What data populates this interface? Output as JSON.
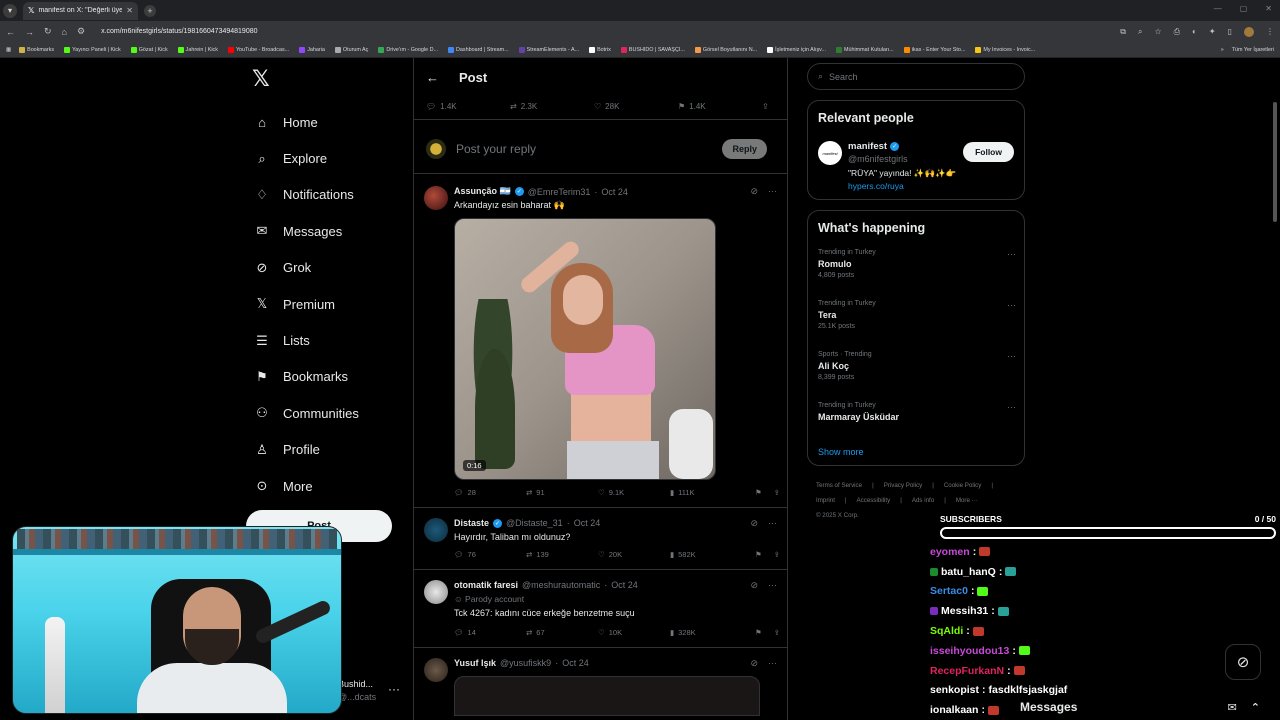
{
  "browser": {
    "tab_title": "manifest on X: \"Değerli üyemiz...",
    "url": "x.com/m6nifestgirls/status/1981660473494819080",
    "bookmarks": [
      {
        "label": "Bookmarks",
        "color": "#d0b24a"
      },
      {
        "label": "Yayıncı Paneli | Kick",
        "color": "#53fc18"
      },
      {
        "label": "Gözat | Kick",
        "color": "#53fc18"
      },
      {
        "label": "Jahrein | Kick",
        "color": "#53fc18"
      },
      {
        "label": "YouTube - Broadcas...",
        "color": "#ff0000"
      },
      {
        "label": "Jaharia",
        "color": "#9146ff"
      },
      {
        "label": "Oturum Aç",
        "color": "#aaaaaa"
      },
      {
        "label": "Drive'ım - Google D...",
        "color": "#34a853"
      },
      {
        "label": "Dashboard | Stream...",
        "color": "#4285f4"
      },
      {
        "label": "StreamElements - A...",
        "color": "#6441a5"
      },
      {
        "label": "Botrix",
        "color": "#ffffff"
      },
      {
        "label": "BUSHIDO | SAVAŞÇI...",
        "color": "#e0245e"
      },
      {
        "label": "Görsel Boyutlanını N...",
        "color": "#f2994a"
      },
      {
        "label": "İşletmeniz için Alışv...",
        "color": "#ffffff"
      },
      {
        "label": "Mühimmat Kutuları...",
        "color": "#2e7d32"
      },
      {
        "label": "ikas - Enter Your Sto...",
        "color": "#ff8a00"
      },
      {
        "label": "My Invoices - Invoic...",
        "color": "#f5c518"
      }
    ],
    "bookmarks_right": "Tüm Yer İşaretleri"
  },
  "nav": {
    "items": [
      {
        "label": "Home",
        "icon": "home-icon"
      },
      {
        "label": "Explore",
        "icon": "search-icon"
      },
      {
        "label": "Notifications",
        "icon": "bell-icon"
      },
      {
        "label": "Messages",
        "icon": "envelope-icon"
      },
      {
        "label": "Grok",
        "icon": "grok-icon"
      },
      {
        "label": "Premium",
        "icon": "x-premium-icon"
      },
      {
        "label": "Lists",
        "icon": "list-icon"
      },
      {
        "label": "Bookmarks",
        "icon": "bookmark-icon"
      },
      {
        "label": "Communities",
        "icon": "communities-icon"
      },
      {
        "label": "Profile",
        "icon": "person-icon"
      },
      {
        "label": "More",
        "icon": "more-circle-icon"
      }
    ],
    "post_button": "Post",
    "account_name": "Bushid...",
    "account_handle": "@...dcats"
  },
  "center": {
    "title": "Post",
    "main_post_stats": {
      "replies": "1.4K",
      "reposts": "2.3K",
      "likes": "28K",
      "bookmarks": "1.4K"
    },
    "reply_placeholder": "Post your reply",
    "reply_button": "Reply",
    "replies": [
      {
        "name": "Assunção 🇦🇷",
        "handle": "@EmreTerim31",
        "date": "Oct 24",
        "text": "Arkandayız esin baharat 🙌",
        "video_time": "0:16",
        "stats": {
          "replies": "28",
          "reposts": "91",
          "likes": "9.1K",
          "views": "111K"
        }
      },
      {
        "name": "Distaste",
        "handle": "@Distaste_31",
        "date": "Oct 24",
        "text": "Hayırdır, Taliban mı oldunuz?",
        "stats": {
          "replies": "76",
          "reposts": "139",
          "likes": "20K",
          "views": "582K"
        }
      },
      {
        "name": "otomatik faresi",
        "handle": "@meshurautomatic",
        "date": "Oct 24",
        "parody": "Parody account",
        "text": "Tck 4267: kadını cüce erkeğe benzetme suçu",
        "stats": {
          "replies": "14",
          "reposts": "67",
          "likes": "10K",
          "views": "328K"
        }
      },
      {
        "name": "Yusuf Işık",
        "handle": "@yusufiskk9",
        "date": "Oct 24"
      }
    ]
  },
  "right": {
    "search_placeholder": "Search",
    "relevant_title": "Relevant people",
    "relevant": {
      "name": "manifest",
      "handle": "@m6nifestgirls",
      "bio": "\"RÜYA\" yayında! ✨🙌✨👉",
      "link": "hypers.co/ruya",
      "follow": "Follow",
      "avatar_text": "manifest"
    },
    "happening_title": "What's happening",
    "trends": [
      {
        "category": "Trending in Turkey",
        "name": "Romulo",
        "count": "4,809 posts"
      },
      {
        "category": "Trending in Turkey",
        "name": "Tera",
        "count": "25.1K posts"
      },
      {
        "category": "Sports · Trending",
        "name": "Ali Koç",
        "count": "8,399 posts"
      },
      {
        "category": "Trending in Turkey",
        "name": "Marmaray Üsküdar",
        "count": ""
      }
    ],
    "show_more": "Show more",
    "footer": [
      "Terms of Service",
      "|",
      "Privacy Policy",
      "|",
      "Cookie Policy",
      "|",
      "Imprint",
      "|",
      "Accessibility",
      "|",
      "Ads info",
      "|",
      "More ···",
      "© 2025 X Corp."
    ]
  },
  "overlay": {
    "subs_label": "SUBSCRIBERS",
    "subs_count": "0 / 50",
    "subs_progress": 0,
    "chat": [
      {
        "user": "eyomen",
        "color": "#c84ad8",
        "badge": "",
        "msg": "",
        "emote": "#c0392b"
      },
      {
        "user": "batu_hanQ",
        "color": "#ffffff",
        "badge": "#1e8a2e",
        "msg": "",
        "emote": "#2aa198"
      },
      {
        "user": "Sertac0",
        "color": "#3a8de8",
        "badge": "",
        "msg": "",
        "emote": "#53fc18"
      },
      {
        "user": "Messih31",
        "color": "#ffffff",
        "badge": "#7b2cbf",
        "msg": "",
        "emote": "#2aa198"
      },
      {
        "user": "SqAldi",
        "color": "#7cfc00",
        "badge": "",
        "msg": "",
        "emote": "#c0392b"
      },
      {
        "user": "isseihyoudou13",
        "color": "#c84ad8",
        "badge": "",
        "msg": "",
        "emote": "#53fc18"
      },
      {
        "user": "RecepFurkanN",
        "color": "#e0245e",
        "badge": "",
        "msg": "",
        "emote": "#c0392b"
      },
      {
        "user": "senkopist",
        "color": "#ffffff",
        "badge": "",
        "msg": "fasdklfsjaskgjaf",
        "emote": ""
      },
      {
        "user": "ionalkaan",
        "color": "#ffffff",
        "badge": "",
        "msg": "",
        "emote": "#c0392b"
      }
    ]
  },
  "dock": {
    "messages_label": "Messages"
  }
}
